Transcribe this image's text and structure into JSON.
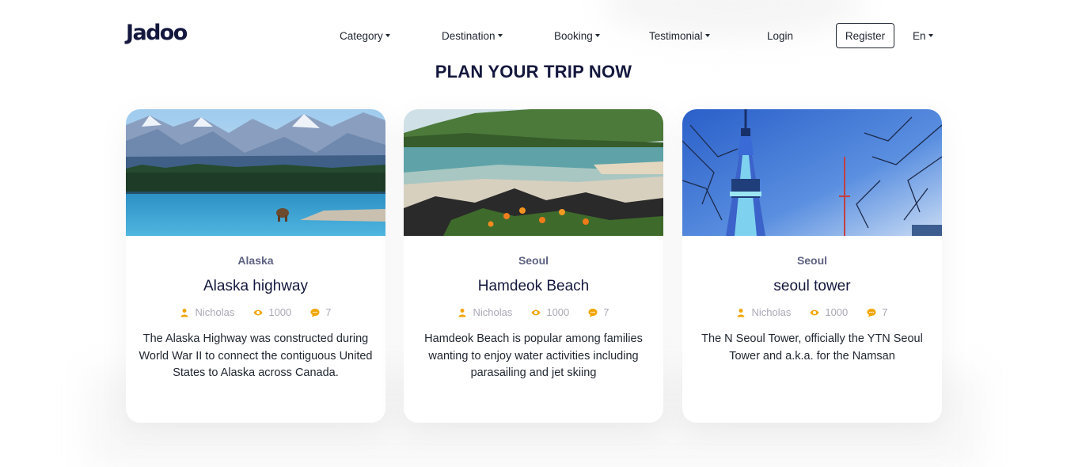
{
  "brand": {
    "logo_text": "Jadoo",
    "accent_colors": [
      "#F1A501",
      "#DF6951"
    ]
  },
  "nav": {
    "items": [
      {
        "label": "Category",
        "dropdown": true
      },
      {
        "label": "Destination",
        "dropdown": true
      },
      {
        "label": "Booking",
        "dropdown": true
      },
      {
        "label": "Testimonial",
        "dropdown": true
      },
      {
        "label": "Login",
        "dropdown": false
      }
    ],
    "register_label": "Register",
    "language": {
      "label": "En",
      "dropdown": true
    }
  },
  "section": {
    "title": "PLAN YOUR TRIP NOW"
  },
  "cards": [
    {
      "location": "Alaska",
      "title": "Alaska highway",
      "author": "Nicholas",
      "views": "1000",
      "comments": "7",
      "description": "The Alaska Highway was constructed during World War II to connect the contiguous United States to Alaska across Canada.",
      "image": "alaska-lake-mountains-bear"
    },
    {
      "location": "Seoul",
      "title": "Hamdeok Beach",
      "author": "Nicholas",
      "views": "1000",
      "comments": "7",
      "description": "Hamdeok Beach is popular among families wanting to enjoy water activities including parasailing and jet skiing",
      "image": "beach-rocks-flowers"
    },
    {
      "location": "Seoul",
      "title": "seoul tower",
      "author": "Nicholas",
      "views": "1000",
      "comments": "7",
      "description": "The N Seoul Tower, officially the YTN Seoul Tower and a.k.a. for the Namsan",
      "image": "seoul-tower-blue-sky"
    }
  ],
  "icons": {
    "author": "user-icon",
    "views": "eye-icon",
    "comments": "comment-icon",
    "color": "#F1A501"
  }
}
